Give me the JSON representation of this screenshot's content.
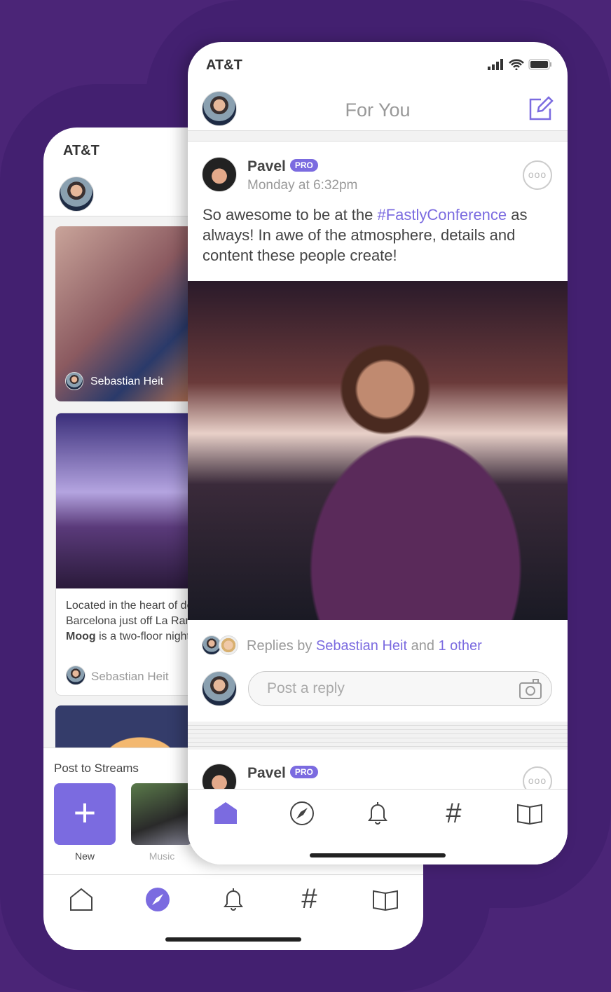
{
  "colors": {
    "accent": "#7b6be0",
    "background": "#4b2577"
  },
  "back": {
    "carrier": "AT&T",
    "cards": [
      {
        "author": "Sebastian Heit"
      },
      {
        "text_parts": [
          "Located in the heart of downtown Barcelona just off La Rambla, ",
          "Moog",
          " is a two-floor nightclub"
        ],
        "author": "Sebastian Heit"
      }
    ],
    "streams": {
      "title": "Post to Streams",
      "items": [
        {
          "label": "New",
          "icon": "plus-icon"
        },
        {
          "label": "Music",
          "icon": "lock-icon"
        }
      ]
    },
    "nav": [
      "home-icon",
      "compass-icon",
      "bell-icon",
      "hashtag-icon",
      "book-icon"
    ],
    "active_nav": "compass-icon"
  },
  "front": {
    "carrier": "AT&T",
    "header": {
      "title": "For You",
      "compose_icon": "compose-icon"
    },
    "post": {
      "author": "Pavel",
      "badge": "PRO",
      "time": "Monday at 6:32pm",
      "text_before": "So awesome to be at the ",
      "hashtag": "#FastlyConference",
      "text_after": " as always! In awe of the atmosphere, details and content these people create!",
      "replies": {
        "prefix": "Replies by ",
        "name": "Sebastian Heit",
        "mid": " and ",
        "other": "1 other"
      },
      "reply_placeholder": "Post a reply"
    },
    "next_post": {
      "author": "Pavel",
      "badge": "PRO"
    },
    "nav": [
      "home-icon",
      "compass-icon",
      "bell-icon",
      "hashtag-icon",
      "book-icon"
    ],
    "active_nav": "home-icon"
  }
}
